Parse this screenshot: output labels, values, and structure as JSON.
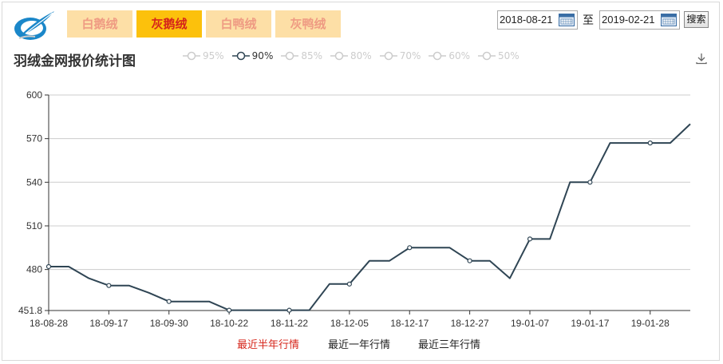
{
  "tabs": [
    {
      "label": "白鹅绒",
      "active": false
    },
    {
      "label": "灰鹅绒",
      "active": true
    },
    {
      "label": "白鸭绒",
      "active": false
    },
    {
      "label": "灰鸭绒",
      "active": false
    }
  ],
  "date_range": {
    "start": "2018-08-21",
    "separator": "至",
    "end": "2019-02-21"
  },
  "search_label": "搜索",
  "title": "羽绒金网报价统计图",
  "legend": [
    {
      "label": "95%",
      "active": false
    },
    {
      "label": "90%",
      "active": true
    },
    {
      "label": "85%",
      "active": false
    },
    {
      "label": "80%",
      "active": false
    },
    {
      "label": "70%",
      "active": false
    },
    {
      "label": "60%",
      "active": false
    },
    {
      "label": "50%",
      "active": false
    }
  ],
  "bottom_links": [
    {
      "label": "最近半年行情",
      "active": true
    },
    {
      "label": "最近一年行情",
      "active": false
    },
    {
      "label": "最近三年行情",
      "active": false
    }
  ],
  "colors": {
    "line": "#2f4554",
    "active_tab": "#fcc10c",
    "inactive_tab": "#fddfa6",
    "active_link": "#d6261b"
  },
  "chart_data": {
    "type": "line",
    "title": "羽绒金网报价统计图",
    "series": [
      {
        "name": "90%",
        "color": "#2f4554"
      }
    ],
    "x_ticks": [
      "18-08-28",
      "18-09-17",
      "18-09-30",
      "18-10-22",
      "18-11-22",
      "18-12-05",
      "18-12-17",
      "18-12-27",
      "19-01-07",
      "19-01-17",
      "19-01-28"
    ],
    "y_ticks": [
      451.8,
      480,
      510,
      540,
      570,
      600
    ],
    "ylim": [
      451.8,
      600
    ],
    "grid": true,
    "points": [
      {
        "x": "18-08-28",
        "y": 482,
        "marker": true
      },
      {
        "y": 482,
        "marker": false
      },
      {
        "y": 474,
        "marker": false
      },
      {
        "x": "18-09-17",
        "y": 469,
        "marker": true
      },
      {
        "y": 469,
        "marker": false
      },
      {
        "y": 464,
        "marker": false
      },
      {
        "x": "18-09-30",
        "y": 458,
        "marker": true
      },
      {
        "y": 458,
        "marker": false
      },
      {
        "y": 458,
        "marker": false
      },
      {
        "x": "18-10-22",
        "y": 452,
        "marker": true
      },
      {
        "y": 452,
        "marker": false
      },
      {
        "y": 452,
        "marker": false
      },
      {
        "x": "18-11-22",
        "y": 452,
        "marker": true
      },
      {
        "y": 452,
        "marker": false
      },
      {
        "y": 470,
        "marker": false
      },
      {
        "x": "18-12-05",
        "y": 470,
        "marker": true
      },
      {
        "y": 486,
        "marker": false
      },
      {
        "y": 486,
        "marker": false
      },
      {
        "x": "18-12-17",
        "y": 495,
        "marker": true
      },
      {
        "y": 495,
        "marker": false
      },
      {
        "y": 495,
        "marker": false
      },
      {
        "x": "18-12-27",
        "y": 486,
        "marker": true
      },
      {
        "y": 486,
        "marker": false
      },
      {
        "y": 474,
        "marker": false
      },
      {
        "x": "19-01-07",
        "y": 501,
        "marker": true
      },
      {
        "y": 501,
        "marker": false
      },
      {
        "y": 540,
        "marker": false
      },
      {
        "x": "19-01-17",
        "y": 540,
        "marker": true
      },
      {
        "y": 567,
        "marker": false
      },
      {
        "y": 567,
        "marker": false
      },
      {
        "x": "19-01-28",
        "y": 567,
        "marker": true
      },
      {
        "y": 567,
        "marker": false
      },
      {
        "y": 580,
        "marker": false
      }
    ]
  }
}
